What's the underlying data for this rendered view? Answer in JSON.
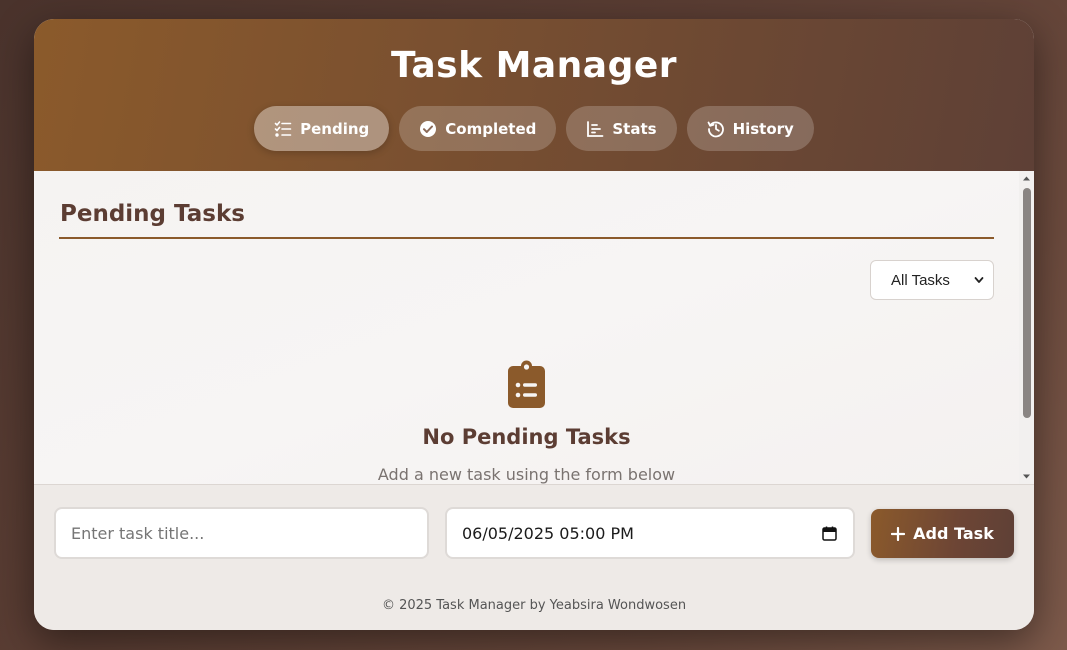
{
  "header": {
    "title": "Task Manager",
    "tabs": [
      {
        "label": "Pending",
        "icon": "list-check-icon",
        "active": true
      },
      {
        "label": "Completed",
        "icon": "check-circle-icon",
        "active": false
      },
      {
        "label": "Stats",
        "icon": "bar-chart-icon",
        "active": false
      },
      {
        "label": "History",
        "icon": "history-icon",
        "active": false
      }
    ]
  },
  "main": {
    "section_title": "Pending Tasks",
    "filter": {
      "selected": "All Tasks"
    },
    "empty_state": {
      "icon": "clipboard-list-icon",
      "title": "No Pending Tasks",
      "subtitle": "Add a new task using the form below"
    }
  },
  "form": {
    "task_placeholder": "Enter task title...",
    "date_value": "06/05/2025 05:00 PM",
    "add_label": "Add Task"
  },
  "footer": {
    "text": "© 2025 Task Manager by Yeabsira Wondwosen"
  },
  "colors": {
    "accent": "#8b5a2b",
    "dark_brown": "#5c3d33"
  }
}
